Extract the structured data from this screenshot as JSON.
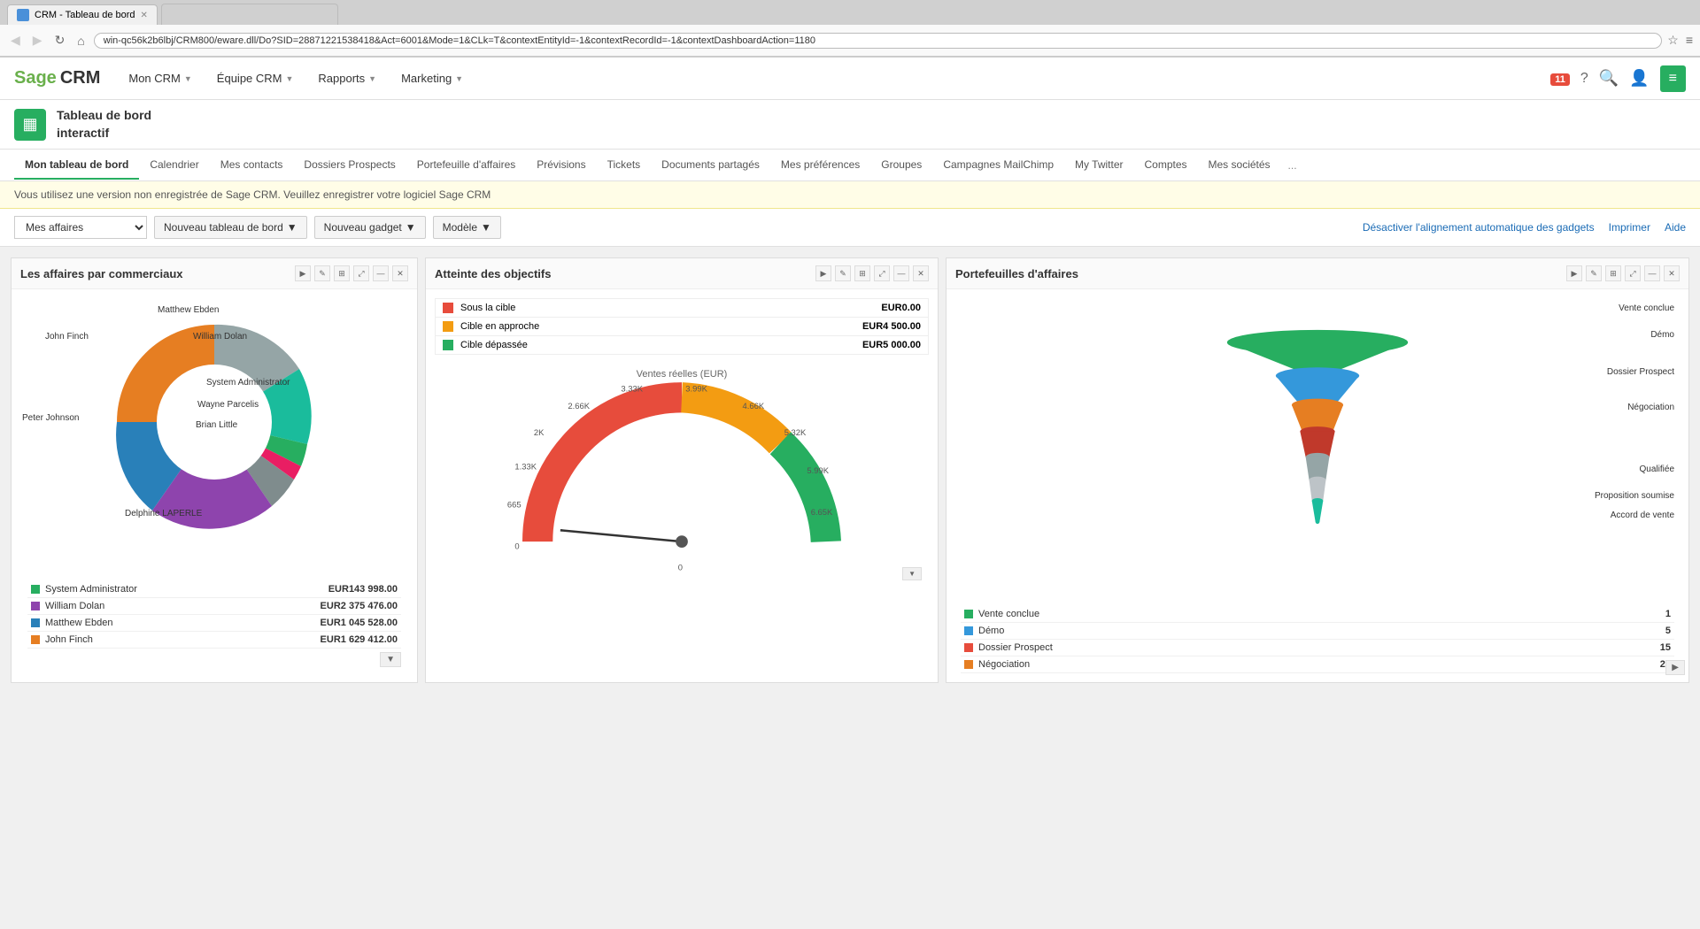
{
  "browser": {
    "tab_label": "CRM - Tableau de bord",
    "url": "win-qc56k2b6lbj/CRM800/eware.dll/Do?SID=28871221538418&Act=6001&Mode=1&CLk=T&contextEntityId=-1&contextRecordId=-1&contextDashboardAction=1180",
    "nav_back": "←",
    "nav_forward": "→",
    "nav_refresh": "↻",
    "nav_home": "⌂"
  },
  "header": {
    "logo_sage": "Sage",
    "logo_crm": "CRM",
    "nav_items": [
      {
        "label": "Mon CRM",
        "id": "mon-crm"
      },
      {
        "label": "Équipe CRM",
        "id": "equipe-crm"
      },
      {
        "label": "Rapports",
        "id": "rapports"
      },
      {
        "label": "Marketing",
        "id": "marketing"
      }
    ]
  },
  "page_title": {
    "icon_symbol": "▦",
    "line1": "Tableau de bord",
    "line2": "interactif"
  },
  "sub_nav": {
    "items": [
      {
        "label": "Mon tableau de bord",
        "active": true
      },
      {
        "label": "Calendrier"
      },
      {
        "label": "Mes contacts"
      },
      {
        "label": "Dossiers Prospects"
      },
      {
        "label": "Portefeuille d'affaires"
      },
      {
        "label": "Prévisions"
      },
      {
        "label": "Tickets"
      },
      {
        "label": "Documents partagés"
      },
      {
        "label": "Mes préférences"
      },
      {
        "label": "Groupes"
      },
      {
        "label": "Campagnes MailChimp"
      },
      {
        "label": "My Twitter"
      },
      {
        "label": "Comptes"
      },
      {
        "label": "Mes sociétés"
      }
    ],
    "more": "..."
  },
  "warning": {
    "text": "Vous utilisez une version non enregistrée de Sage CRM. Veuillez enregistrer votre logiciel Sage CRM"
  },
  "toolbar": {
    "select_value": "Mes affaires",
    "btn1": "Nouveau tableau de bord",
    "btn2": "Nouveau gadget",
    "btn3": "Modèle",
    "action1": "Désactiver l'alignement automatique des gadgets",
    "action2": "Imprimer",
    "action3": "Aide"
  },
  "panel1": {
    "title": "Les affaires par commerciaux",
    "legend": [
      {
        "color": "#27ae60",
        "name": "System Administrator",
        "value": "EUR143 998.00"
      },
      {
        "color": "#8e44ad",
        "name": "William Dolan",
        "value": "EUR2 375 476.00"
      },
      {
        "color": "#2980b9",
        "name": "Matthew Ebden",
        "value": "EUR1 045 528.00"
      },
      {
        "color": "#e67e22",
        "name": "John Finch",
        "value": "EUR1 629 412.00"
      }
    ],
    "donut_labels": [
      {
        "text": "Matthew Ebden",
        "top": "12%",
        "left": "42%"
      },
      {
        "text": "William Dolan",
        "top": "22%",
        "left": "62%"
      },
      {
        "text": "System Administrator",
        "top": "38%",
        "left": "60%"
      },
      {
        "text": "Wayne Parcelis",
        "top": "48%",
        "left": "57%"
      },
      {
        "text": "Brian Little",
        "top": "56%",
        "left": "55%"
      },
      {
        "text": "John Finch",
        "top": "22%",
        "left": "10%"
      },
      {
        "text": "Peter Johnson",
        "top": "50%",
        "left": "2%"
      },
      {
        "text": "Delphine LAPERLE",
        "top": "75%",
        "left": "38%"
      }
    ]
  },
  "panel2": {
    "title": "Atteinte des objectifs",
    "legend_items": [
      {
        "color": "#e74c3c",
        "name": "Sous la cible",
        "value": "EUR0.00"
      },
      {
        "color": "#f39c12",
        "name": "Cible en approche",
        "value": "EUR4 500.00"
      },
      {
        "color": "#27ae60",
        "name": "Cible dépassée",
        "value": "EUR5 000.00"
      }
    ],
    "gauge_label": "Ventes réelles (EUR)",
    "gauge_ticks": [
      "0",
      "665",
      "1.33K",
      "2K",
      "2.66K",
      "3.33K",
      "3.99K",
      "4.66K",
      "5.32K",
      "5.99K",
      "6.65K"
    ],
    "bottom_label": "0"
  },
  "panel3": {
    "title": "Portefeuilles d'affaires",
    "funnel_labels": [
      {
        "text": "Vente conclue",
        "position": "top-right"
      },
      {
        "text": "Démo",
        "position": "upper-right"
      },
      {
        "text": "Dossier Prospect",
        "position": "mid-right"
      },
      {
        "text": "Négociation",
        "position": "lower-mid-right"
      },
      {
        "text": "Qualifiée",
        "position": "lower-right"
      },
      {
        "text": "Proposition soumise",
        "position": "bottom-right"
      },
      {
        "text": "Accord de vente",
        "position": "bottom-right2"
      }
    ],
    "funnel_legend": [
      {
        "color": "#27ae60",
        "name": "Vente conclue",
        "value": "1"
      },
      {
        "color": "#3498db",
        "name": "Démo",
        "value": "5"
      },
      {
        "color": "#e74c3c",
        "name": "Dossier Prospect",
        "value": "15"
      },
      {
        "color": "#e67e22",
        "name": "Négociation",
        "value": "23"
      }
    ]
  }
}
